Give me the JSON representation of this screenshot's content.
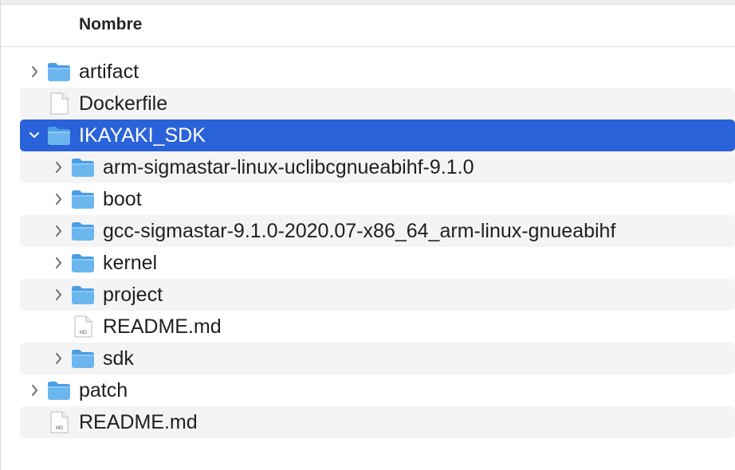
{
  "header": {
    "column_name": "Nombre"
  },
  "rows": [
    {
      "label": "artifact",
      "kind": "folder",
      "icon": "folder-icon",
      "depth": 0,
      "expanded": false
    },
    {
      "label": "Dockerfile",
      "kind": "file",
      "icon": "file-icon",
      "depth": 0
    },
    {
      "label": "IKAYAKI_SDK",
      "kind": "folder",
      "icon": "folder-icon",
      "depth": 0,
      "expanded": true,
      "selected": true
    },
    {
      "label": "arm-sigmastar-linux-uclibcgnueabihf-9.1.0",
      "kind": "folder",
      "icon": "folder-icon",
      "depth": 1,
      "expanded": false
    },
    {
      "label": "boot",
      "kind": "folder",
      "icon": "folder-icon",
      "depth": 1,
      "expanded": false
    },
    {
      "label": "gcc-sigmastar-9.1.0-2020.07-x86_64_arm-linux-gnueabihf",
      "kind": "folder",
      "icon": "folder-icon",
      "depth": 1,
      "expanded": false
    },
    {
      "label": "kernel",
      "kind": "folder",
      "icon": "folder-icon",
      "depth": 1,
      "expanded": false
    },
    {
      "label": "project",
      "kind": "folder",
      "icon": "folder-icon",
      "depth": 1,
      "expanded": false
    },
    {
      "label": "README.md",
      "kind": "md",
      "icon": "markdown-file-icon",
      "icon_text": "MD",
      "depth": 1
    },
    {
      "label": "sdk",
      "kind": "folder",
      "icon": "folder-icon",
      "depth": 1,
      "expanded": false
    },
    {
      "label": "patch",
      "kind": "folder",
      "icon": "folder-icon",
      "depth": 0,
      "expanded": false
    },
    {
      "label": "README.md",
      "kind": "md",
      "icon": "markdown-file-icon",
      "icon_text": "MD",
      "depth": 0
    }
  ],
  "colors": {
    "selection": "#2a62d9",
    "stripe": "#f4f4f4",
    "folder_body": "#6cb6ef",
    "folder_tab": "#4a9ee4"
  }
}
